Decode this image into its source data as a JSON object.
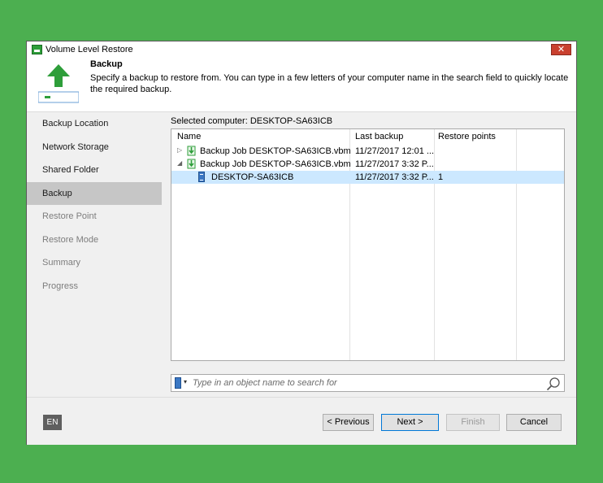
{
  "window": {
    "title": "Volume Level Restore",
    "close_label": "✕"
  },
  "header": {
    "title": "Backup",
    "description": "Specify a backup to restore from. You can type in a few letters of your computer name in the search field to quickly locate the required backup."
  },
  "sidebar": {
    "items": [
      {
        "label": "Backup Location",
        "state": "done"
      },
      {
        "label": "Network Storage",
        "state": "done"
      },
      {
        "label": "Shared Folder",
        "state": "done"
      },
      {
        "label": "Backup",
        "state": "active"
      },
      {
        "label": "Restore Point",
        "state": "disabled"
      },
      {
        "label": "Restore Mode",
        "state": "disabled"
      },
      {
        "label": "Summary",
        "state": "disabled"
      },
      {
        "label": "Progress",
        "state": "disabled"
      }
    ]
  },
  "main": {
    "selected_computer": "Selected computer: DESKTOP-SA63ICB",
    "columns": {
      "name": "Name",
      "last_backup": "Last backup",
      "restore_points": "Restore points"
    },
    "rows": [
      {
        "name": "Backup Job DESKTOP-SA63ICB.vbm",
        "last_backup": "11/27/2017 12:01 ...",
        "restore_points": "",
        "expander": "▷",
        "icon": "backup-file-icon"
      },
      {
        "name": "Backup Job DESKTOP-SA63ICB.vbm",
        "last_backup": "11/27/2017 3:32 P...",
        "restore_points": "",
        "expander": "◢",
        "icon": "backup-file-icon"
      },
      {
        "name": "DESKTOP-SA63ICB",
        "last_backup": "11/27/2017 3:32 P...",
        "restore_points": "1",
        "expander": "",
        "icon": "computer-icon",
        "selected": true
      }
    ],
    "search": {
      "placeholder": "Type in an object name to search for",
      "caret": "▾"
    }
  },
  "footer": {
    "language": "EN",
    "previous": "< Previous",
    "next": "Next >",
    "finish": "Finish",
    "cancel": "Cancel"
  },
  "colors": {
    "background": "#4caf50",
    "active_nav": "#c6c6c6",
    "selected_row": "#cce8ff",
    "accent": "#0078d7"
  }
}
